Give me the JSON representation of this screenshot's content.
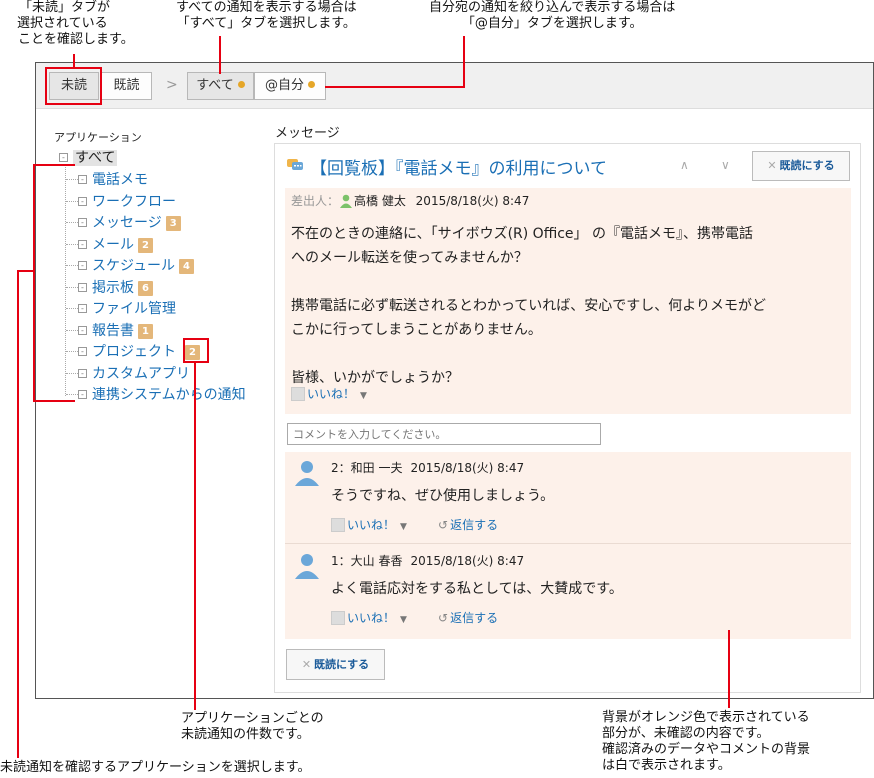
{
  "annotations": {
    "unread_tab": [
      "「未読」タブが",
      "選択されている",
      "ことを確認します。"
    ],
    "all_tab": [
      "すべての通知を表示する場合は",
      "「すべて」タブを選択します。"
    ],
    "self_tab": [
      "自分宛の通知を絞り込んで表示する場合は",
      "「@自分」タブを選択します。"
    ],
    "counts": [
      "アプリケーションごとの",
      "未読通知の件数です。"
    ],
    "select_app": "未読通知を確認するアプリケーションを選択します。",
    "background": [
      "背景がオレンジ色で表示されている",
      "部分が、未確認の内容です。",
      "確認済みのデータやコメントの背景",
      "は白で表示されます。"
    ]
  },
  "toolbar": {
    "unread_label": "未読",
    "read_label": "既読",
    "separator": ">",
    "all_label": "すべて",
    "self_label": "@自分"
  },
  "sidebar": {
    "title": "アプリケーション",
    "root_label": "すべて",
    "items": [
      {
        "label": "電話メモ",
        "count": ""
      },
      {
        "label": "ワークフロー",
        "count": ""
      },
      {
        "label": "メッセージ",
        "count": "3"
      },
      {
        "label": "メール",
        "count": "2"
      },
      {
        "label": "スケジュール",
        "count": "4"
      },
      {
        "label": "掲示板",
        "count": "6"
      },
      {
        "label": "ファイル管理",
        "count": ""
      },
      {
        "label": "報告書",
        "count": "1"
      },
      {
        "label": "プロジェクト",
        "count": "2"
      },
      {
        "label": "カスタムアプリ",
        "count": ""
      },
      {
        "label": "連携システムからの通知",
        "count": ""
      }
    ]
  },
  "main": {
    "heading": "メッセージ",
    "subject": "【回覧板】『電話メモ』の利用について",
    "nav_up": "∧",
    "nav_down": "∨",
    "mark_read_label": "既読にする",
    "sender_label": "差出人：",
    "sender_name": "高橋 健太",
    "sender_date": "2015/8/18(火) 8:47",
    "body": [
      "不在のときの連絡に、「サイボウズ(R) Office」 の『電話メモ』、携帯電話",
      "へのメール転送を使ってみませんか？",
      "",
      "携帯電話に必ず転送されるとわかっていれば、安心ですし、何よりメモがど",
      "こかに行ってしまうことがありません。",
      "",
      "皆様、いかがでしょうか？"
    ],
    "like_label": "いいね！",
    "comment_placeholder": "コメントを入力してください。",
    "comments": [
      {
        "author": "2：和田 一夫",
        "date": "2015/8/18(火) 8:47",
        "text": "そうですね、ぜひ使用しましょう。",
        "like": "いいね！",
        "reply": "返信する"
      },
      {
        "author": "1：大山 春香",
        "date": "2015/8/18(火) 8:47",
        "text": "よく電話応対をする私としては、大賛成です。",
        "like": "いいね！",
        "reply": "返信する"
      }
    ],
    "bottom_mark_read_label": "既読にする"
  },
  "colors": {
    "annotation_line": "#e60012",
    "unread_background": "#fdf1ea",
    "link": "#1a6fb5",
    "badge": "#e4b77a",
    "tab_dot": "#e5a628"
  }
}
